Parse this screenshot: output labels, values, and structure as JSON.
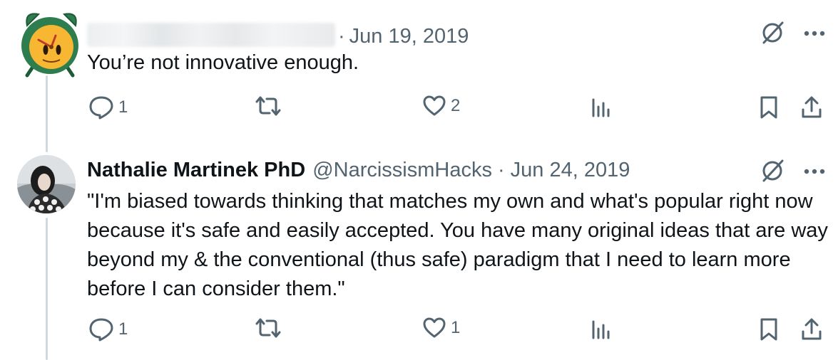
{
  "tweets": [
    {
      "display_name": "",
      "handle": "",
      "separator": "·",
      "date": "Jun 19, 2019",
      "text": "You’re not innovative enough.",
      "reply_count": "1",
      "retweet_count": "",
      "like_count": "2",
      "views_count": "",
      "avatar_icon": "alarm-clock-emoji-icon"
    },
    {
      "display_name": "Nathalie Martinek PhD",
      "handle": "@NarcissismHacks",
      "separator": "·",
      "date": "Jun 24, 2019",
      "text": "\"I'm biased towards thinking that matches my own and what's popular right now because it's safe and easily accepted. You have many original ideas that are way beyond my & the conventional (thus safe) paradigm that I need to learn more before I can consider them.\"",
      "reply_count": "1",
      "retweet_count": "",
      "like_count": "1",
      "views_count": "",
      "avatar_icon": "profile-photo"
    }
  ],
  "icons": {
    "grok": "grok-slash-icon",
    "more": "more-icon",
    "reply": "reply-icon",
    "retweet": "retweet-icon",
    "like": "like-icon",
    "views": "views-icon",
    "bookmark": "bookmark-icon",
    "share": "share-icon"
  },
  "colors": {
    "text": "#0f1419",
    "secondary": "#536471",
    "thread_line": "#cfd9de",
    "clock_green": "#2e7d4f",
    "clock_face": "#f7b733"
  }
}
